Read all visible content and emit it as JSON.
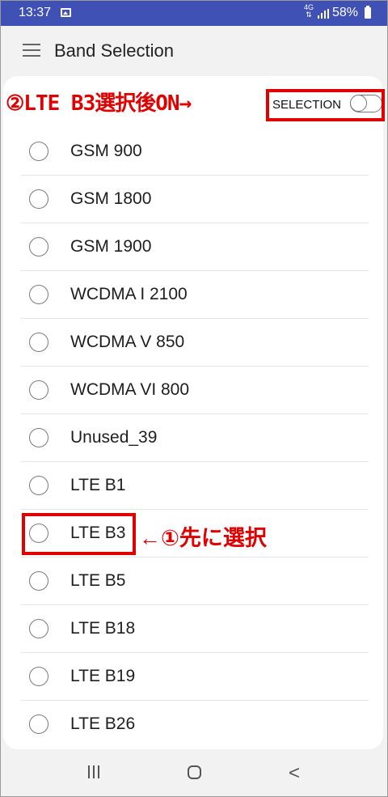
{
  "status_bar": {
    "time": "13:37",
    "network": "4G",
    "battery": "58%",
    "icons": [
      "image-icon",
      "network-4g-icon",
      "signal-icon",
      "battery-icon"
    ]
  },
  "toolbar": {
    "title": "Band Selection",
    "menu_icon": "hamburger-menu-icon"
  },
  "selection": {
    "label": "SELECTION",
    "toggle_on": false
  },
  "bands": [
    {
      "label": "GSM 900",
      "selected": false
    },
    {
      "label": "GSM 1800",
      "selected": false
    },
    {
      "label": "GSM 1900",
      "selected": false
    },
    {
      "label": "WCDMA I 2100",
      "selected": false
    },
    {
      "label": "WCDMA V 850",
      "selected": false
    },
    {
      "label": "WCDMA VI 800",
      "selected": false
    },
    {
      "label": "Unused_39",
      "selected": false
    },
    {
      "label": "LTE B1",
      "selected": false
    },
    {
      "label": "LTE B3",
      "selected": false
    },
    {
      "label": "LTE B5",
      "selected": false
    },
    {
      "label": "LTE B18",
      "selected": false
    },
    {
      "label": "LTE B19",
      "selected": false
    },
    {
      "label": "LTE B26",
      "selected": false
    }
  ],
  "annotations": {
    "top": "②LTE B3選択後ON→",
    "b3": "←①先に選択",
    "color": "#e00000"
  },
  "nav_bar": {
    "icons": [
      "recent-apps-icon",
      "home-icon",
      "back-icon"
    ],
    "back_glyph": "<"
  },
  "colors": {
    "status_bar": "#3f51b5",
    "background": "#f2f2f2",
    "card": "#ffffff"
  }
}
